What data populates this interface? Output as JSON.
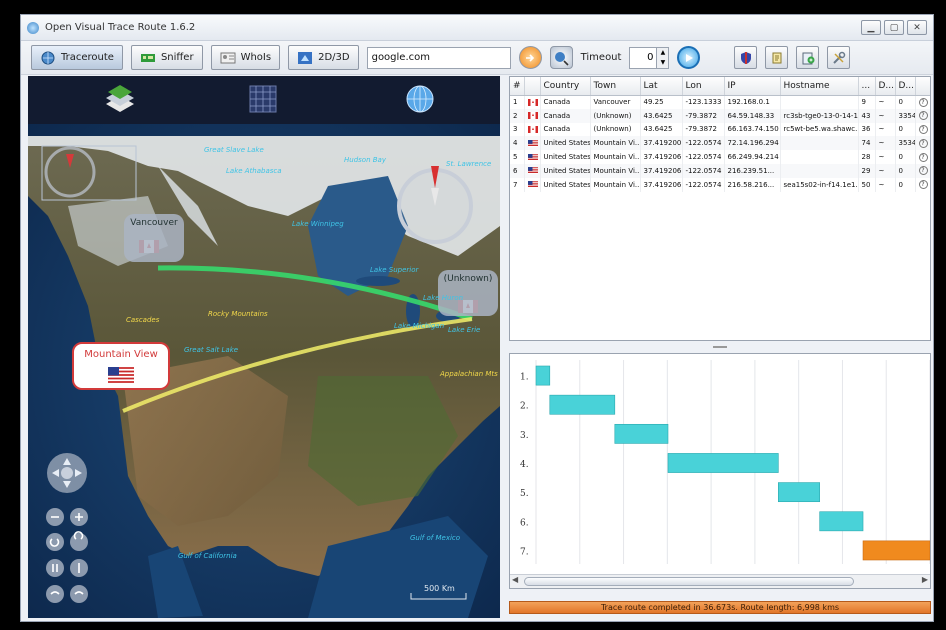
{
  "window": {
    "title": "Open Visual Trace Route 1.6.2"
  },
  "toolbar": {
    "traceroute": "Traceroute",
    "sniffer": "Sniffer",
    "whois": "WhoIs",
    "view_mode": "2D/3D",
    "host": "google.com",
    "timeout_label": "Timeout",
    "timeout_value": "0"
  },
  "map": {
    "pins": {
      "vancouver": "Vancouver",
      "unknown": "(Unknown)",
      "mountain_view": "Mountain View"
    },
    "labels": {
      "hudson_bay": "Hudson Bay",
      "lake_athabasca": "Lake Athabasca",
      "lake_winnipeg": "Lake Winnipeg",
      "lake_superior": "Lake Superior",
      "lake_michigan": "Lake Michigan",
      "lake_erie": "Lake Erie",
      "lake_huron": "Lake Huron",
      "cascades": "Cascades",
      "rocky_mountains": "Rocky Mountains",
      "great_salt_lake": "Great Salt Lake",
      "appalachian": "Appalachian Mts",
      "gulf_mexico": "Gulf of Mexico",
      "gulf_california": "Gulf of California",
      "st_lawrence": "St. Lawrence",
      "great_slave": "Great Slave Lake"
    },
    "scale": "500 Km"
  },
  "table": {
    "columns": [
      "#",
      "",
      "Country",
      "Town",
      "Lat",
      "Lon",
      "IP",
      "Hostname",
      "...",
      "D...",
      "D...",
      ""
    ],
    "rows": [
      [
        "1",
        "ca",
        "Canada",
        "Vancouver",
        "49.25",
        "-123.1333",
        "192.168.0.1",
        "",
        "9",
        "~",
        "0",
        "?"
      ],
      [
        "2",
        "ca",
        "Canada",
        "(Unknown)",
        "43.6425",
        "-79.3872",
        "64.59.148.33",
        "rc3sb-tge0-13-0-14-1...",
        "43",
        "~",
        "3354",
        "?"
      ],
      [
        "3",
        "ca",
        "Canada",
        "(Unknown)",
        "43.6425",
        "-79.3872",
        "66.163.74.150",
        "rc5wt-be5.wa.shawc...",
        "36",
        "~",
        "0",
        "?"
      ],
      [
        "4",
        "us",
        "United States",
        "Mountain Vi...",
        "37.419200",
        "-122.0574",
        "72.14.196.294",
        "",
        "74",
        "~",
        "3534",
        "?"
      ],
      [
        "5",
        "us",
        "United States",
        "Mountain Vi...",
        "37.419206",
        "-122.0574",
        "66.249.94.214",
        "",
        "28",
        "~",
        "0",
        "?"
      ],
      [
        "6",
        "us",
        "United States",
        "Mountain Vi...",
        "37.419206",
        "-122.0574",
        "216.239.51...",
        "",
        "29",
        "~",
        "0",
        "?"
      ],
      [
        "7",
        "us",
        "United States",
        "Mountain Vi...",
        "37.419206",
        "-122.0574",
        "216.58.216...",
        "sea15s02-in-f14.1e1...",
        "50",
        "~",
        "0",
        "?"
      ]
    ]
  },
  "gantt": {
    "hop_labels": [
      "1.",
      "2.",
      "3.",
      "4.",
      "5.",
      "6.",
      "7."
    ]
  },
  "status": {
    "text": "Trace route completed in 36.673s. Route length: 6,998 kms"
  },
  "colors": {
    "bar": "#49d2d8",
    "last_bar": "#f08a1e",
    "route_green": "#34d36a",
    "route_yellow": "#f2ee6a",
    "status": "#e9853a"
  }
}
